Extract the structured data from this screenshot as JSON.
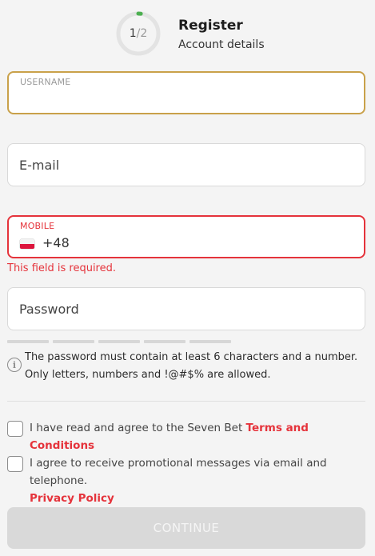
{
  "header": {
    "step_current": "1",
    "step_total": "/2",
    "step_progress": 0.02,
    "title": "Register",
    "subtitle": "Account details"
  },
  "fields": {
    "username": {
      "label": "USERNAME",
      "value": ""
    },
    "email": {
      "placeholder": "E-mail",
      "value": ""
    },
    "mobile": {
      "label": "MOBILE",
      "prefix": "+48",
      "flag": "poland-flag",
      "error": "This field is required."
    },
    "password": {
      "placeholder": "Password",
      "value": ""
    }
  },
  "strength_segments": 5,
  "hint": {
    "icon": "info-icon",
    "text_line1": "The password must contain at least 6 characters and a number.",
    "text_line2": "Only letters, numbers and !@#$% are allowed."
  },
  "agreements": {
    "terms": {
      "text": "I have read and agree to the Seven Bet ",
      "link": "Terms and Conditions",
      "checked": false
    },
    "promo": {
      "text": "I agree to receive promotional messages via email and telephone.",
      "link": "Privacy Policy",
      "checked": false
    }
  },
  "continue_label": "CONTINUE",
  "colors": {
    "accent_gold": "#c9a14a",
    "error_red": "#e5333b",
    "progress_green": "#4caf50",
    "disabled_button": "#d9d9d9"
  }
}
